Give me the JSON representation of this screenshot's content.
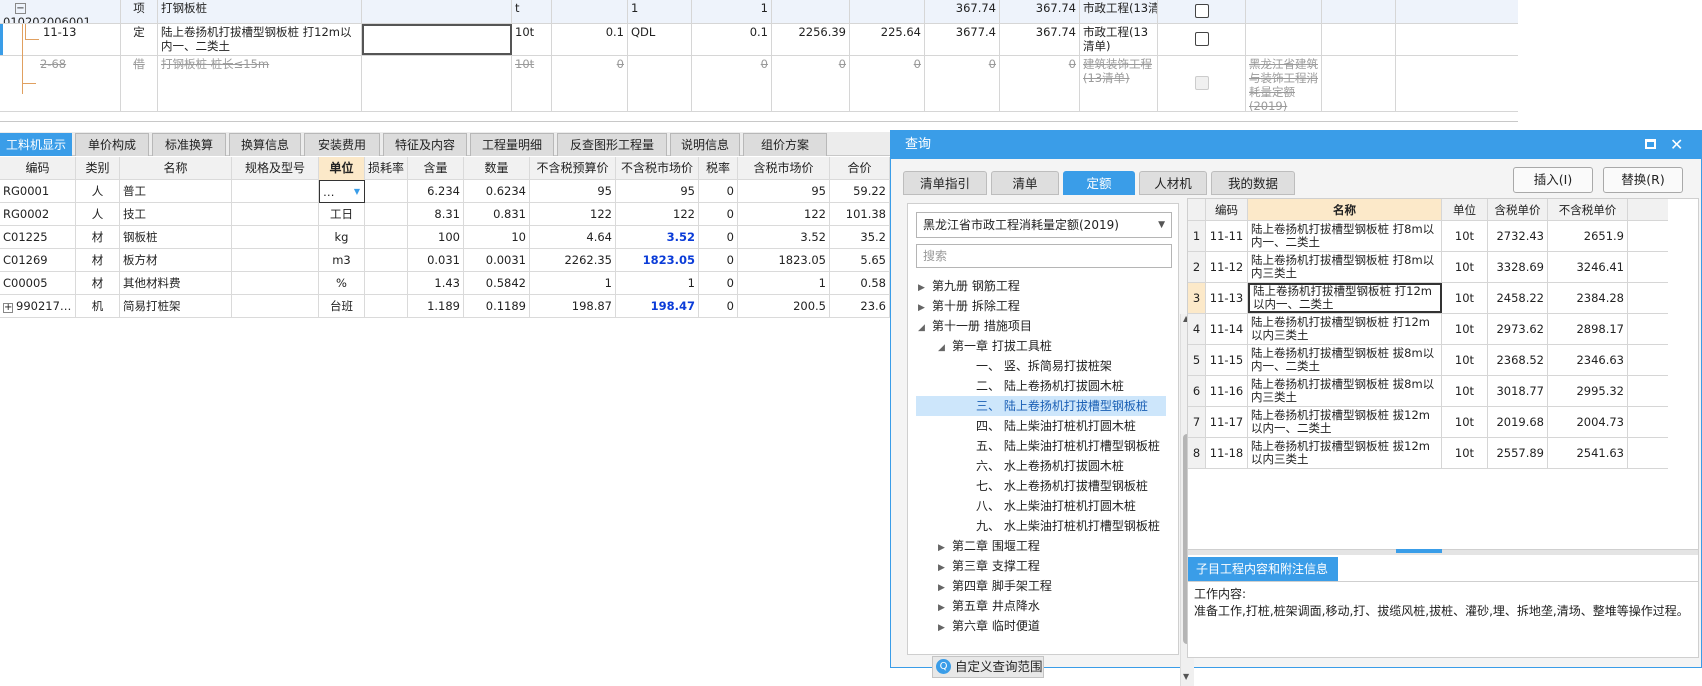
{
  "top_rows": [
    {
      "code": "010202006001",
      "type": "项",
      "name": "打钢板桩",
      "unit": "t",
      "qty_expr": "",
      "qty_code": "1",
      "qty": "1",
      "price1": "",
      "price2": "",
      "total1": "367.74",
      "total2": "367.74",
      "spec": "市政工程(13清…",
      "note": ""
    },
    {
      "code": "11-13",
      "type": "定",
      "name": "陆上卷扬机打拔槽型钢板桩 打12m以内一、二类土",
      "unit": "10t",
      "qty_expr": "0.1",
      "qty_code": "QDL",
      "qty": "0.1",
      "price1": "2256.39",
      "price2": "225.64",
      "total1": "3677.4",
      "total2": "367.74",
      "spec": "市政工程(13清单)",
      "note": ""
    },
    {
      "code": "2-68",
      "type": "借",
      "name": "打钢板桩 桩长≤15m",
      "unit": "10t",
      "qty_expr": "0",
      "qty_code": "",
      "qty": "0",
      "price1": "0",
      "price2": "0",
      "total1": "0",
      "total2": "0",
      "spec": "建筑装饰工程(13清单)",
      "note": "黑龙江省建筑与装饰工程消耗量定额(2019)"
    }
  ],
  "bottom_tabs": [
    "工料机显示",
    "单价构成",
    "标准换算",
    "换算信息",
    "安装费用",
    "特征及内容",
    "工程量明细",
    "反查图形工程量",
    "说明信息",
    "组价方案"
  ],
  "bottom_headers": [
    "编码",
    "类别",
    "名称",
    "规格及型号",
    "单位",
    "损耗率",
    "含量",
    "数量",
    "不含税预算价",
    "不含税市场价",
    "税率",
    "含税市场价",
    "合价"
  ],
  "bottom_rows": [
    {
      "code": "RG0001",
      "cat": "人",
      "name": "普工",
      "spec": "",
      "unit": "…",
      "loss": "",
      "content": "6.234",
      "qty": "0.6234",
      "budget": "95",
      "market": "95",
      "tax": "0",
      "taxmarket": "95",
      "total": "59.22"
    },
    {
      "code": "RG0002",
      "cat": "人",
      "name": "技工",
      "spec": "",
      "unit": "工日",
      "loss": "",
      "content": "8.31",
      "qty": "0.831",
      "budget": "122",
      "market": "122",
      "tax": "0",
      "taxmarket": "122",
      "total": "101.38"
    },
    {
      "code": "C01225",
      "cat": "材",
      "name": "钢板桩",
      "spec": "",
      "unit": "kg",
      "loss": "",
      "content": "100",
      "qty": "10",
      "budget": "4.64",
      "market": "3.52",
      "tax": "0",
      "taxmarket": "3.52",
      "total": "35.2"
    },
    {
      "code": "C01269",
      "cat": "材",
      "name": "板方材",
      "spec": "",
      "unit": "m3",
      "loss": "",
      "content": "0.031",
      "qty": "0.0031",
      "budget": "2262.35",
      "market": "1823.05",
      "tax": "0",
      "taxmarket": "1823.05",
      "total": "5.65"
    },
    {
      "code": "C00005",
      "cat": "材",
      "name": "其他材料费",
      "spec": "",
      "unit": "%",
      "loss": "",
      "content": "1.43",
      "qty": "0.5842",
      "budget": "1",
      "market": "1",
      "tax": "0",
      "taxmarket": "1",
      "total": "0.58"
    },
    {
      "code": "990217…",
      "cat": "机",
      "name": "简易打桩架",
      "spec": "",
      "unit": "台班",
      "loss": "",
      "content": "1.189",
      "qty": "0.1189",
      "budget": "198.87",
      "market": "198.47",
      "tax": "0",
      "taxmarket": "200.5",
      "total": "23.6"
    }
  ],
  "dialog": {
    "title": "查询",
    "tabs": [
      "清单指引",
      "清单",
      "定额",
      "人材机",
      "我的数据"
    ],
    "insert_label": "插入(I)",
    "replace_label": "替换(R)",
    "library": "黑龙江省市政工程消耗量定额(2019)",
    "search_placeholder": "搜索",
    "tree": [
      {
        "label": "第九册 钢筋工程",
        "level": 0,
        "arrow": "▶"
      },
      {
        "label": "第十册 拆除工程",
        "level": 0,
        "arrow": "▶"
      },
      {
        "label": "第十一册 措施项目",
        "level": 0,
        "arrow": "◢"
      },
      {
        "label": "第一章 打拔工具桩",
        "level": 1,
        "arrow": "◢"
      },
      {
        "label": "一、 竖、拆简易打拔桩架",
        "level": 2,
        "arrow": ""
      },
      {
        "label": "二、 陆上卷扬机打拔圆木桩",
        "level": 2,
        "arrow": ""
      },
      {
        "label": "三、 陆上卷扬机打拔槽型钢板桩",
        "level": 2,
        "arrow": ""
      },
      {
        "label": "四、 陆上柴油打桩机打圆木桩",
        "level": 2,
        "arrow": ""
      },
      {
        "label": "五、 陆上柴油打桩机打槽型钢板桩",
        "level": 2,
        "arrow": ""
      },
      {
        "label": "六、 水上卷扬机打拔圆木桩",
        "level": 2,
        "arrow": ""
      },
      {
        "label": "七、 水上卷扬机打拔槽型钢板桩",
        "level": 2,
        "arrow": ""
      },
      {
        "label": "八、 水上柴油打桩机打圆木桩",
        "level": 2,
        "arrow": ""
      },
      {
        "label": "九、 水上柴油打桩机打槽型钢板桩",
        "level": 2,
        "arrow": ""
      },
      {
        "label": "第二章 围堰工程",
        "level": 1,
        "arrow": "▶"
      },
      {
        "label": "第三章 支撑工程",
        "level": 1,
        "arrow": "▶"
      },
      {
        "label": "第四章 脚手架工程",
        "level": 1,
        "arrow": "▶"
      },
      {
        "label": "第五章 井点降水",
        "level": 1,
        "arrow": "▶"
      },
      {
        "label": "第六章 临时便道",
        "level": 1,
        "arrow": "▶"
      }
    ],
    "custom_scope": "自定义查询范围",
    "result_headers": [
      "编码",
      "名称",
      "单位",
      "含税单价",
      "不含税单价"
    ],
    "results": [
      {
        "idx": "1",
        "code": "11-11",
        "name": "陆上卷扬机打拔槽型钢板桩 打8m以内一、二类土",
        "unit": "10t",
        "taxprice": "2732.43",
        "price": "2651.9"
      },
      {
        "idx": "2",
        "code": "11-12",
        "name": "陆上卷扬机打拔槽型钢板桩 打8m以内三类土",
        "unit": "10t",
        "taxprice": "3328.69",
        "price": "3246.41"
      },
      {
        "idx": "3",
        "code": "11-13",
        "name": "陆上卷扬机打拔槽型钢板桩 打12m以内一、二类土",
        "unit": "10t",
        "taxprice": "2458.22",
        "price": "2384.28"
      },
      {
        "idx": "4",
        "code": "11-14",
        "name": "陆上卷扬机打拔槽型钢板桩 打12m以内三类土",
        "unit": "10t",
        "taxprice": "2973.62",
        "price": "2898.17"
      },
      {
        "idx": "5",
        "code": "11-15",
        "name": "陆上卷扬机打拔槽型钢板桩 拔8m以内一、二类土",
        "unit": "10t",
        "taxprice": "2368.52",
        "price": "2346.63"
      },
      {
        "idx": "6",
        "code": "11-16",
        "name": "陆上卷扬机打拔槽型钢板桩 拔8m以内三类土",
        "unit": "10t",
        "taxprice": "3018.77",
        "price": "2995.32"
      },
      {
        "idx": "7",
        "code": "11-17",
        "name": "陆上卷扬机打拔槽型钢板桩 拔12m以内一、二类土",
        "unit": "10t",
        "taxprice": "2019.68",
        "price": "2004.73"
      },
      {
        "idx": "8",
        "code": "11-18",
        "name": "陆上卷扬机打拔槽型钢板桩 拔12m以内三类土",
        "unit": "10t",
        "taxprice": "2557.89",
        "price": "2541.63"
      }
    ],
    "info_tab": "子目工程内容和附注信息",
    "info_label": "工作内容:",
    "info_text": "准备工作,打桩,桩架调面,移动,打、拔缆风桩,拔桩、灌砂,埋、拆地垄,清场、整堆等操作过程。"
  },
  "colors": {
    "accent": "#3a9de8",
    "highlight": "#fce9c9",
    "blue_text": "#0b3cd8"
  }
}
